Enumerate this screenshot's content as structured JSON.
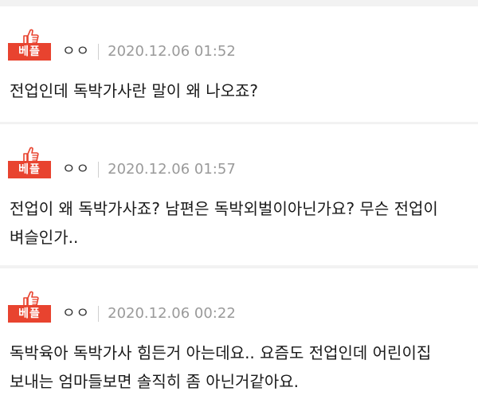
{
  "comments": [
    {
      "badge": "베플",
      "user": "ㅇㅇ",
      "date": "2020.12.06 01:52",
      "text": "전업인데 독박가사란 말이 왜 나오죠?"
    },
    {
      "badge": "베플",
      "user": "ㅇㅇ",
      "date": "2020.12.06 01:57",
      "text": "전업이 왜 독박가사죠? 남편은 독박외벌이아닌가요? 무슨 전업이 벼슬인가.."
    },
    {
      "badge": "베플",
      "user": "ㅇㅇ",
      "date": "2020.12.06 00:22",
      "text": "독박육아 독박가사 힘든거 아는데요.. 요즘도 전업인데 어린이집 보내는 엄마들보면 솔직히 좀 아닌거같아요."
    }
  ],
  "colors": {
    "badge": "#e8432f",
    "date": "#9a9a9a",
    "divider": "#f2f2f2"
  },
  "icons": {
    "badge_icon": "thumbs-up-icon"
  }
}
